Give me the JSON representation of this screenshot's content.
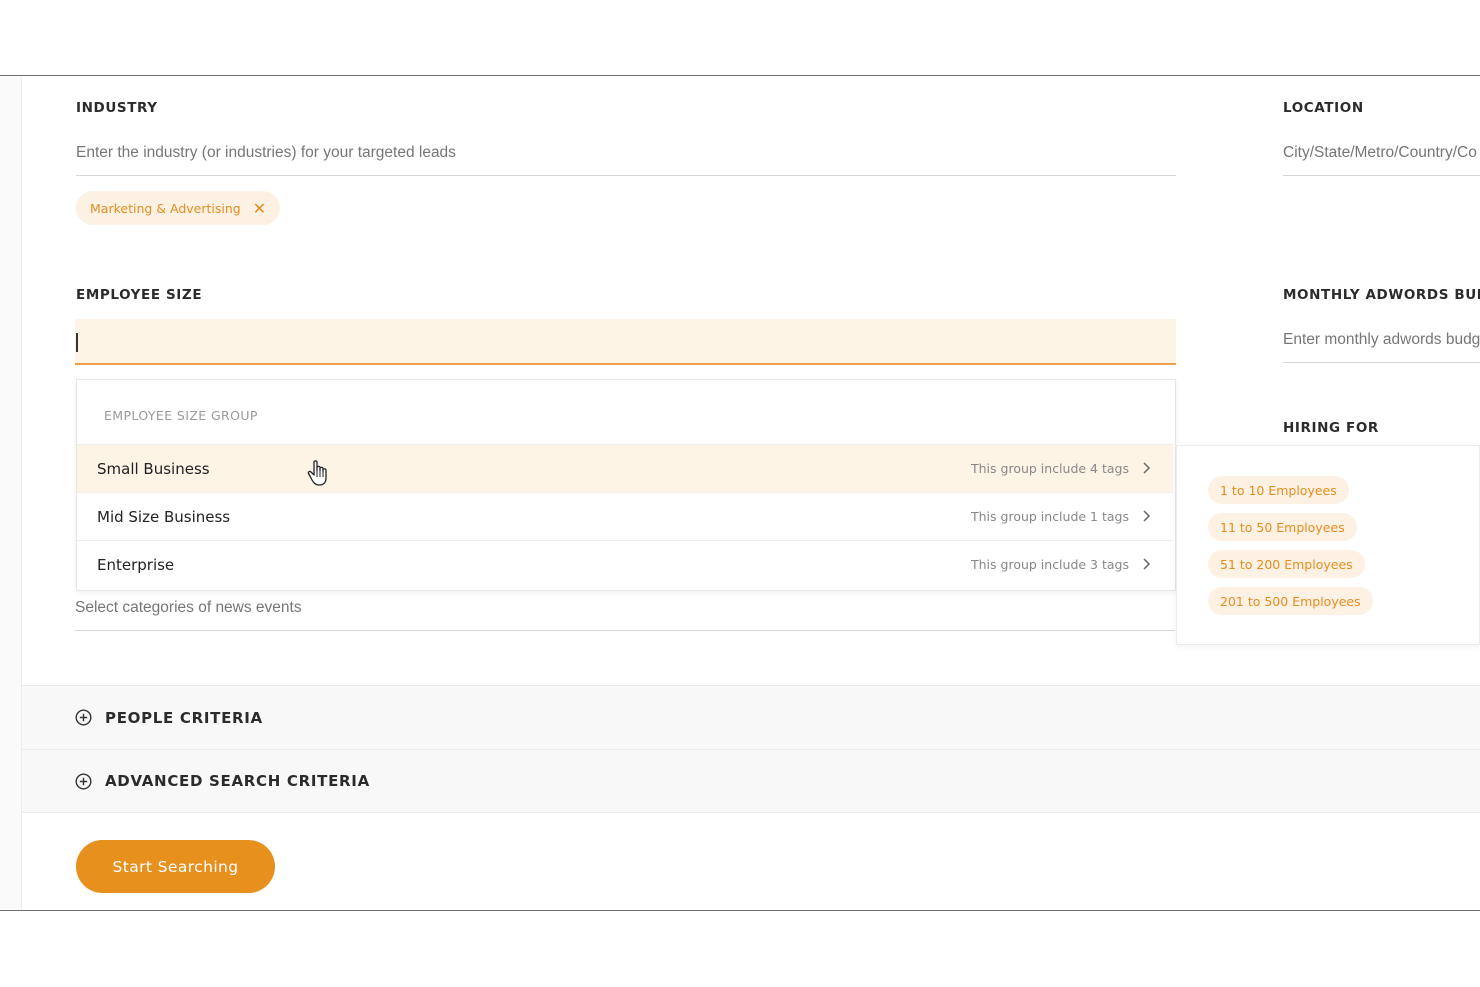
{
  "industry": {
    "label": "INDUSTRY",
    "placeholder": "Enter the industry (or industries) for your targeted leads",
    "selected_tag": "Marketing & Advertising"
  },
  "location": {
    "label": "LOCATION",
    "placeholder": "City/State/Metro/Country/Co"
  },
  "employee_size": {
    "label": "EMPLOYEE SIZE",
    "value": "",
    "dropdown": {
      "header": "EMPLOYEE SIZE GROUP",
      "rows": [
        {
          "name": "Small Business",
          "meta": "This group include 4 tags"
        },
        {
          "name": "Mid Size Business",
          "meta": "This group include 1 tags"
        },
        {
          "name": "Enterprise",
          "meta": "This group include 3 tags"
        }
      ]
    },
    "group_tags": [
      "1 to 10 Employees",
      "11 to 50 Employees",
      "51 to 200 Employees",
      "201 to 500 Employees"
    ]
  },
  "monthly_adwords": {
    "label": "MONTHLY ADWORDS BUDGE",
    "placeholder": "Enter monthly adwords budg"
  },
  "hiring_for": {
    "label": "HIRING FOR"
  },
  "news_events": {
    "placeholder": "Select categories of news events"
  },
  "sections": {
    "people": "PEOPLE CRITERIA",
    "advanced": "ADVANCED SEARCH CRITERIA"
  },
  "start_button": "Start Searching",
  "colors": {
    "accent": "#e8901e",
    "chip_bg": "#fdf1e4",
    "hover_bg": "#fdf4e6"
  }
}
